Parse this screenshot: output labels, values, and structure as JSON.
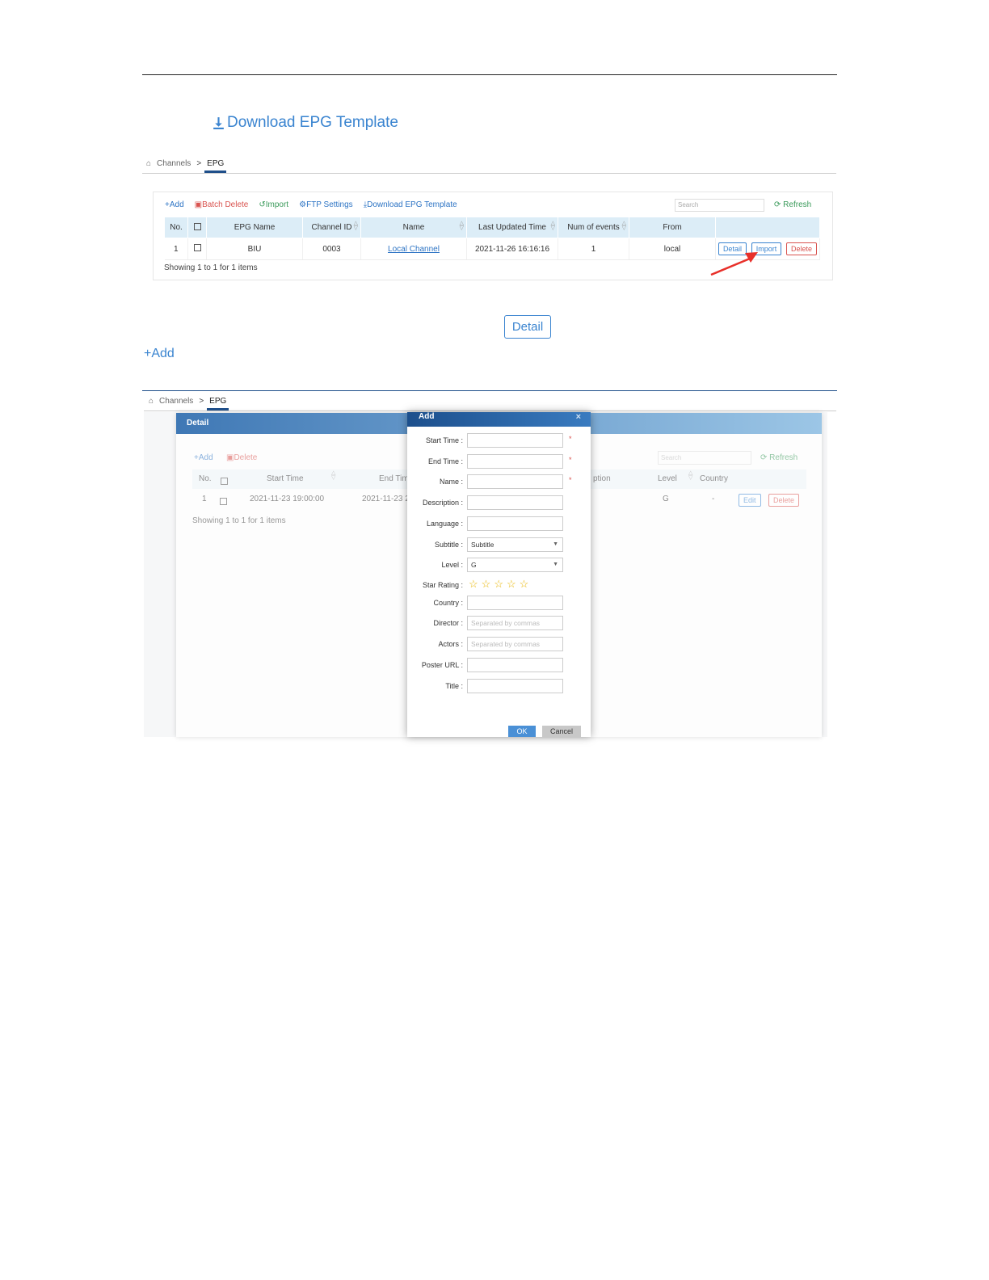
{
  "download_template_big": "Download EPG Template",
  "breadcrumb": {
    "home": "Channels",
    "separator": ">",
    "current": "EPG"
  },
  "toolbar": {
    "add": "+Add",
    "batch_delete": "Batch Delete",
    "import": "Import",
    "ftp_settings": "FTP Settings",
    "download_template": "Download EPG Template",
    "search_placeholder": "Search",
    "refresh": "Refresh"
  },
  "epg_table": {
    "headers": [
      "No.",
      "",
      "EPG Name",
      "Channel ID",
      "Name",
      "Last Updated Time",
      "Num of events",
      "From",
      ""
    ],
    "rows": [
      {
        "no": "1",
        "epg_name": "BIU",
        "channel_id": "0003",
        "name": "Local Channel",
        "last_updated": "2021-11-26 16:16:16",
        "num_events": "1",
        "from": "local"
      }
    ],
    "actions": {
      "detail": "Detail",
      "import": "Import",
      "delete": "Delete"
    },
    "footer": "Showing 1 to 1 for 1 items"
  },
  "callouts": {
    "detail_button": "Detail",
    "add_button": "+Add"
  },
  "detail_dialog": {
    "title": "Detail",
    "toolbar": {
      "add": "+Add",
      "delete": "Delete",
      "search_placeholder": "Search",
      "refresh": "Refresh"
    },
    "headers": {
      "no": "No.",
      "start_time": "Start Time",
      "end_time": "End Tim",
      "description_partial": "ption",
      "level": "Level",
      "country": "Country"
    },
    "row": {
      "no": "1",
      "start_time": "2021-11-23 19:00:00",
      "end_time": "2021-11-23 2",
      "level": "G",
      "country": "-"
    },
    "actions": {
      "edit": "Edit",
      "delete": "Delete"
    },
    "footer": "Showing 1 to 1 for 1 items"
  },
  "add_dialog": {
    "title": "Add",
    "close": "×",
    "fields": {
      "start_time": "Start Time :",
      "end_time": "End Time :",
      "name": "Name :",
      "description": "Description :",
      "language": "Language :",
      "subtitle": "Subtitle :",
      "subtitle_value": "Subtitle",
      "level": "Level :",
      "level_value": "G",
      "star_rating": "Star Rating :",
      "country": "Country :",
      "director": "Director :",
      "director_placeholder": "Separated by commas",
      "actors": "Actors :",
      "actors_placeholder": "Separated by commas",
      "poster_url": "Poster URL :",
      "title": "Title :"
    },
    "required_mark": "*",
    "star_count": 5,
    "ok": "OK",
    "cancel": "Cancel"
  },
  "colors": {
    "accent": "#3a84d0",
    "danger": "#d9534f",
    "success": "#3a9a5a",
    "header_bg": "#dcedf7"
  }
}
